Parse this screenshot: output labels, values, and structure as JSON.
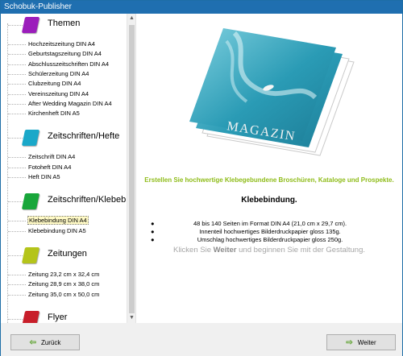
{
  "window": {
    "title": "Schobuk-Publisher"
  },
  "sidebar": {
    "categories": [
      {
        "label": "Themen",
        "color": "#9b1dbb",
        "items": [
          "Hochzeitszeitung DIN A4",
          "Geburtstagszeitung DIN A4",
          "Abschlusszeitschriften DIN A4",
          "Schülerzeitung DIN A4",
          "Clubzeitung DIN A4",
          "Vereinszeitung DIN A4",
          "After Wedding Magazin DIN A4",
          "Kirchenheft DIN A5"
        ]
      },
      {
        "label": "Zeitschriften/Hefte",
        "color": "#1aa8c9",
        "items": [
          "Zeitschrift DIN A4",
          "Fotoheft DIN A4",
          "Heft DIN A5"
        ]
      },
      {
        "label": "Zeitschriften/Klebebindung",
        "color": "#18a63a",
        "items": [
          "Klebebindung DIN A4",
          "Klebebindung DIN A5"
        ],
        "selected_item": "Klebebindung DIN A4"
      },
      {
        "label": "Zeitungen",
        "color": "#b4c41a",
        "items": [
          "Zeitung 23,2 cm x 32,4 cm",
          "Zeitung 28,9 cm x 38,0 cm",
          "Zeitung 35,0 cm x 50,0 cm"
        ]
      },
      {
        "label": "Flyer",
        "color": "#c81e2a",
        "items": []
      }
    ]
  },
  "main": {
    "cover_title": "MAGAZIN",
    "headline": "Erstellen Sie hochwertige Klebegebundene Broschüren, Kataloge und Prospekte.",
    "subhead": "Klebebindung.",
    "bullets": [
      "48 bis 140 Seiten im Format DIN A4 (21,0 cm x 29,7 cm).",
      "Innenteil hochwertiges Bilderdruckpapier gloss 135g.",
      "Umschlag hochwertiges Bilderdruckpapier gloss 250g."
    ],
    "cta_before": "Klicken Sie",
    "cta_bold": "Weiter",
    "cta_after": "und beginnen Sie mit der Gestaltung."
  },
  "footer": {
    "back_label": "Zurück",
    "next_label": "Weiter"
  },
  "colors": {
    "accent_green": "#8fbc1a",
    "titlebar": "#1f6fb0",
    "arrow_green": "#5aa12b"
  }
}
